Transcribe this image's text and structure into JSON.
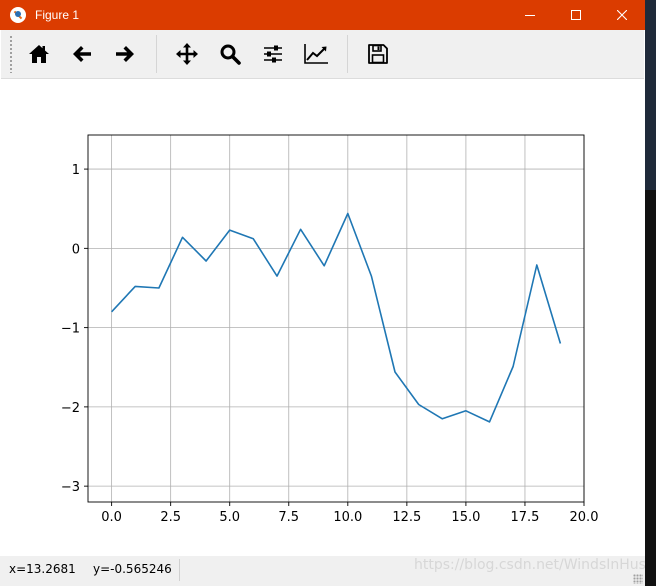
{
  "window": {
    "title": "Figure 1",
    "controls": {
      "minimize": "minimize-icon",
      "maximize": "maximize-icon",
      "close": "close-icon"
    }
  },
  "toolbar": {
    "buttons": [
      {
        "name": "home",
        "icon": "home-icon"
      },
      {
        "name": "back",
        "icon": "arrow-left-icon"
      },
      {
        "name": "forward",
        "icon": "arrow-right-icon"
      },
      {
        "name": "pan",
        "icon": "move-icon"
      },
      {
        "name": "zoom",
        "icon": "magnifier-icon"
      },
      {
        "name": "configure-subplots",
        "icon": "sliders-icon"
      },
      {
        "name": "edit-axis",
        "icon": "line-chart-icon"
      },
      {
        "name": "save",
        "icon": "floppy-disk-icon"
      }
    ]
  },
  "status": {
    "x": "x=13.2681",
    "y": "y=-0.565246",
    "watermark": "https://blog.csdn.net/WindsInHusk"
  },
  "colors": {
    "titlebar": "#db3c00",
    "line": "#1f77b4",
    "grid": "#b0b0b0"
  },
  "chart_data": {
    "type": "line",
    "x": [
      0,
      1,
      2,
      3,
      4,
      5,
      6,
      7,
      8,
      9,
      10,
      11,
      12,
      13,
      14,
      15,
      16,
      17,
      18,
      19
    ],
    "series": [
      {
        "values": [
          -0.8,
          -0.48,
          -0.5,
          0.14,
          -0.16,
          0.23,
          0.12,
          -0.35,
          0.24,
          -0.22,
          0.44,
          -0.35,
          -1.56,
          -1.97,
          -2.15,
          -2.05,
          -2.19,
          -1.49,
          -0.21,
          -1.2
        ]
      }
    ],
    "xlim": [
      -1.0,
      20.0
    ],
    "ylim": [
      -3.2,
      1.43
    ],
    "xticks": [
      0.0,
      2.5,
      5.0,
      7.5,
      10.0,
      12.5,
      15.0,
      17.5,
      20.0
    ],
    "xtick_labels": [
      "0.0",
      "2.5",
      "5.0",
      "7.5",
      "10.0",
      "12.5",
      "15.0",
      "17.5",
      "20.0"
    ],
    "yticks": [
      1,
      0,
      -1,
      -2,
      -3
    ],
    "ytick_labels": [
      "1",
      "0",
      "−1",
      "−2",
      "−3"
    ],
    "grid": true,
    "title": "",
    "xlabel": "",
    "ylabel": ""
  }
}
